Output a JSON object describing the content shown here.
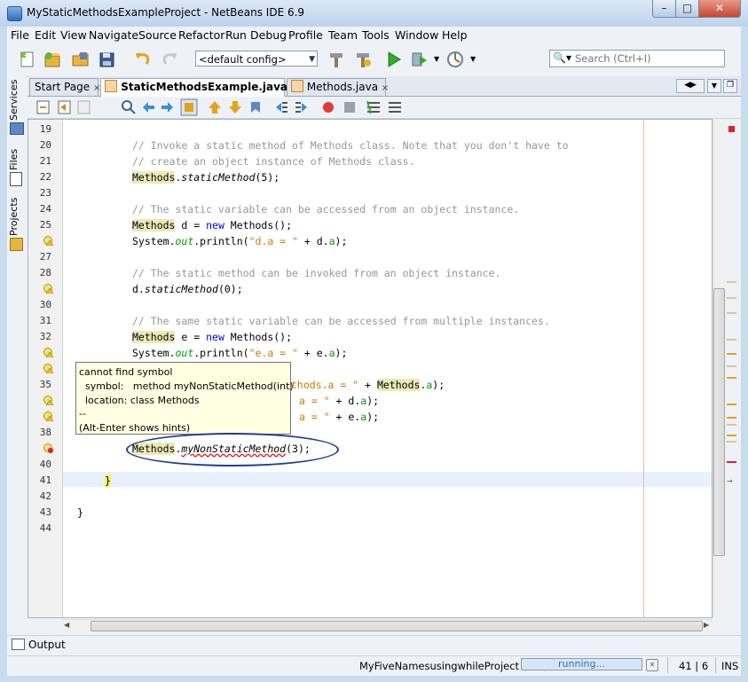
{
  "window": {
    "title": "MyStaticMethodsExampleProject - NetBeans IDE 6.9"
  },
  "menu": [
    "File",
    "Edit",
    "View",
    "Navigate",
    "Source",
    "Refactor",
    "Run",
    "Debug",
    "Profile",
    "Team",
    "Tools",
    "Window",
    "Help"
  ],
  "toolbar": {
    "config": "<default config>",
    "search_placeholder": "Search (Ctrl+I)"
  },
  "sidebar": {
    "services": "Services",
    "files": "Files",
    "projects": "Projects"
  },
  "tabs": {
    "start_page": "Start Page",
    "active": "StaticMethodsExample.java",
    "methods": "Methods.java",
    "close": "×"
  },
  "gutter_numbers": [
    "19",
    "20",
    "21",
    "22",
    "23",
    "24",
    "25",
    "",
    "27",
    "28",
    "",
    "30",
    "31",
    "32",
    "",
    "",
    "35",
    "",
    "",
    "38",
    "",
    "40",
    "41",
    "42",
    "43",
    "44"
  ],
  "code": {
    "l20": "// Invoke a static method of Methods class. Note that you don't have to",
    "l21": "// create an object instance of Methods class.",
    "l22_a": "Methods",
    "l22_b": ".",
    "l22_c": "staticMethod",
    "l22_d": "(5);",
    "l24": "// The static variable can be accessed from an object instance.",
    "l25_a": "Methods",
    "l25_b": " d = ",
    "l25_c": "new",
    "l25_d": " Methods();",
    "l26_a": "System.",
    "l26_b": "out",
    "l26_c": ".println(",
    "l26_d": "\"d.a = \"",
    "l26_e": " + d.",
    "l26_f": "a",
    "l26_g": ");",
    "l28": "// The static method can be invoked from an object instance.",
    "l29_a": "d.",
    "l29_b": "staticMethod",
    "l29_c": "(0);",
    "l31": "// The same static variable can be accessed from multiple instances.",
    "l32_a": "Methods",
    "l32_b": " e = ",
    "l32_c": "new",
    "l32_d": " Methods();",
    "l33_a": "System.",
    "l33_b": "out",
    "l33_c": ".println(",
    "l33_d": "\"e.a = \"",
    "l33_e": " + e.",
    "l33_f": "a",
    "l33_g": ");",
    "l35_a": "thods.a = \"",
    "l35_b": " + ",
    "l35_c": "Methods",
    "l35_d": ".",
    "l35_e": "a",
    "l35_f": ");",
    "l36_a": "a = \"",
    "l36_b": " + d.",
    "l36_c": "a",
    "l36_d": ");",
    "l37_a": "a = \"",
    "l37_b": " + e.",
    "l37_c": "a",
    "l37_d": ");",
    "l39_a": "Methods",
    "l39_b": ".",
    "l39_c": "myNonStaticMethod",
    "l39_d": "(3);",
    "l41": "}",
    "l43": "}"
  },
  "tooltip": {
    "text": "cannot find symbol\n  symbol:   method myNonStaticMethod(int)\n  location: class Methods\n--\n(Alt-Enter shows hints)"
  },
  "output": {
    "label": "Output"
  },
  "status": {
    "project": "MyFiveNamesusingwhileProject (run)",
    "progress": "running...",
    "position": "41 | 6",
    "mode": "INS"
  },
  "colors": {
    "highlight": "#e9eab6",
    "keyword": "#0000e6",
    "comment": "#969696",
    "string": "#ce7b00",
    "field": "#009900",
    "error": "#e00000"
  }
}
